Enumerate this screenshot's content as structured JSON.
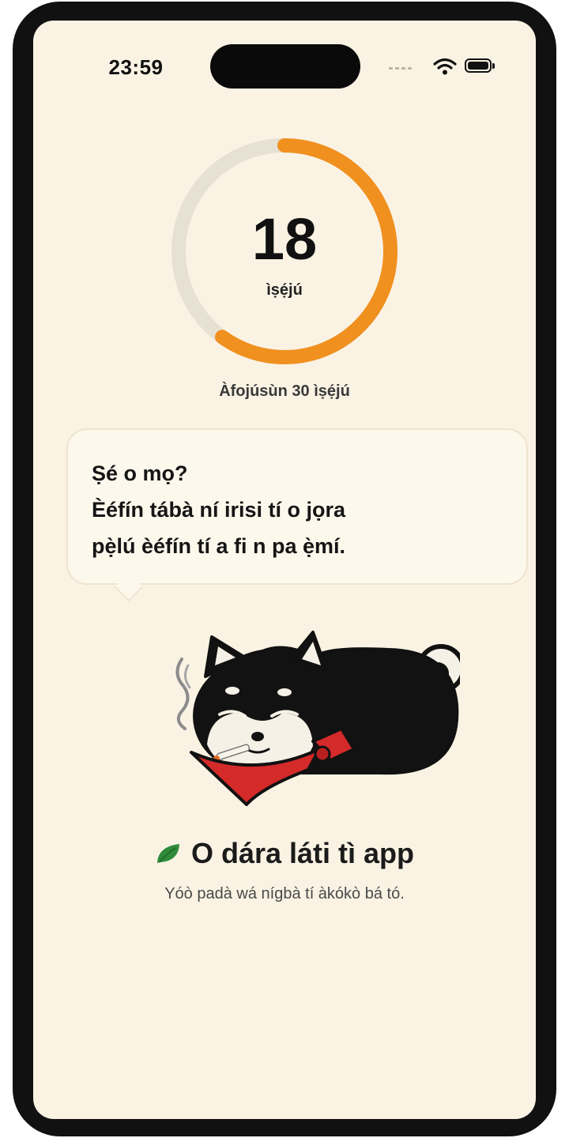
{
  "status_bar": {
    "time": "23:59"
  },
  "progress": {
    "value": 18,
    "unit": "ìṣẹ́jú",
    "goal_text": "Àfojúsùn 30 ìṣẹ́jú",
    "goal_value": 30,
    "fraction": 0.6,
    "track_color": "#e7e1d3",
    "fill_color": "#f0901e"
  },
  "speech_bubble": {
    "lines": [
      "Ṣé o mọ?",
      "Èéfín tábà ní irisi tí o jọra",
      "pẹ̀lú èéfín tí a fi n pa ẹ̀mí."
    ]
  },
  "mascot": {
    "icon": "shiba-dog-smoking-mascot"
  },
  "footer": {
    "icon": "leaf-icon",
    "title": "O dára láti tì app",
    "subtitle": "Yóò padà wá nígbà tí àkókò bá tó."
  },
  "colors": {
    "background": "#faf3e4",
    "accent": "#f0901e",
    "leaf": "#2e8b3a",
    "bandana": "#d42a2a"
  }
}
